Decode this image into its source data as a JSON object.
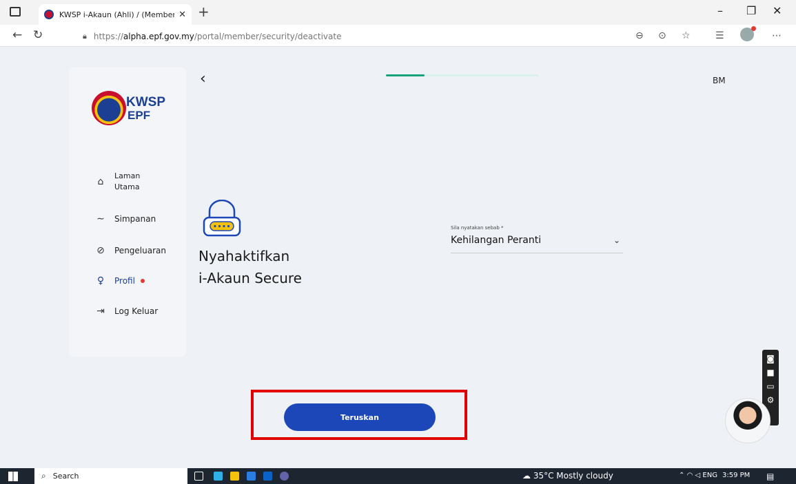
{
  "browser": {
    "tab_title": "KWSP i-Akaun (Ahli) / (Member)",
    "url_prefix": "https://",
    "url_host": "alpha.epf.gov.my",
    "url_path": "/portal/member/security/deactivate"
  },
  "logo": {
    "line1": "KWSP",
    "line2": "EPF"
  },
  "sidebar": {
    "items": [
      {
        "label_1": "Laman",
        "label_2": "Utama",
        "icon": "home-icon"
      },
      {
        "label": "Simpanan",
        "icon": "trend-icon"
      },
      {
        "label": "Pengeluaran",
        "icon": "withdraw-icon"
      },
      {
        "label": "Profil",
        "icon": "person-icon",
        "active": true
      },
      {
        "label": "Log Keluar",
        "icon": "logout-icon"
      }
    ]
  },
  "header": {
    "back": "‹",
    "language": "BM",
    "progress": 0.25
  },
  "main": {
    "title_line1": "Nyahaktifkan",
    "title_line2": "i-Akaun Secure",
    "reason_label": "Sila nyatakan sebab *",
    "reason_value": "Kehilangan Peranti",
    "continue_button": "Teruskan"
  },
  "taskbar": {
    "search_label": "Search",
    "weather": "35°C  Mostly cloudy",
    "lang": "ENG",
    "time": "3:59 PM"
  },
  "colors": {
    "brand_blue": "#1c47b8",
    "highlight_red": "#e00000",
    "progress_green": "#16a27a"
  }
}
